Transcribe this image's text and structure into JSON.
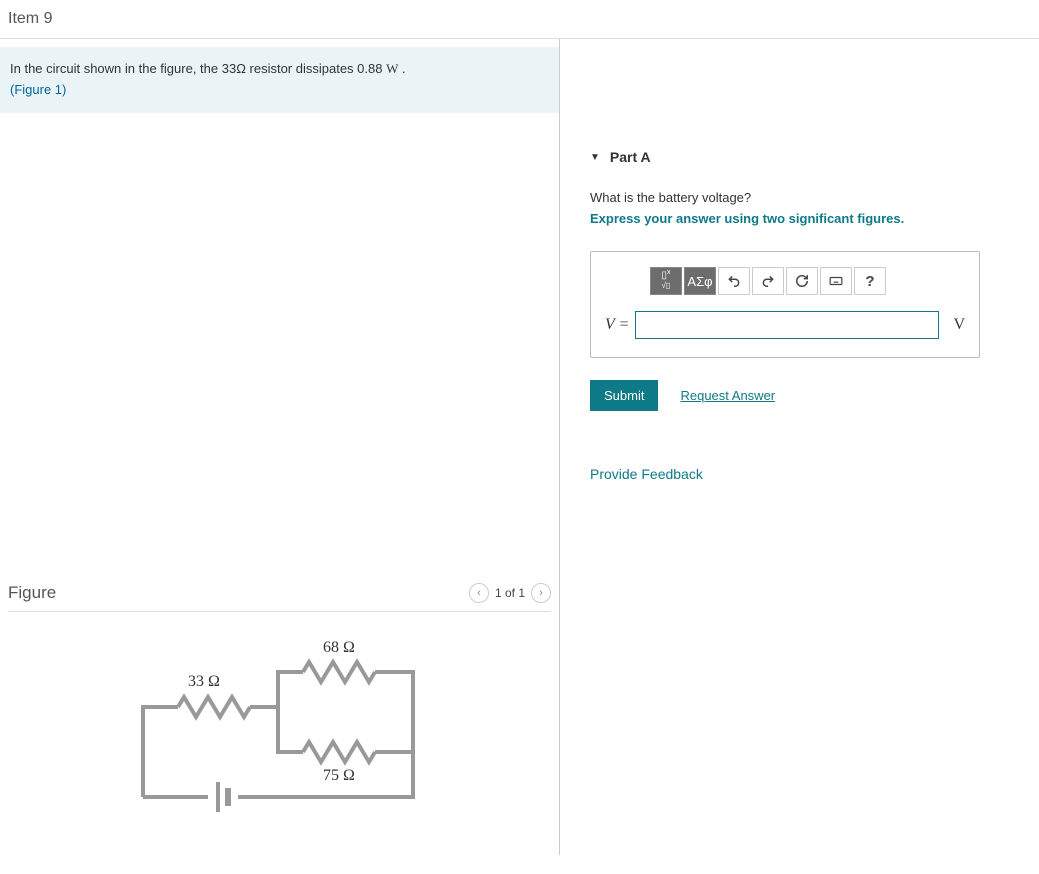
{
  "item_header": "Item 9",
  "problem": {
    "prefix": "In the circuit shown in the figure, the 33",
    "omega1": "Ω",
    "mid": " resistor dissipates 0.88 ",
    "w": "W",
    "suffix": " .",
    "figure_link": "(Figure 1)"
  },
  "figure": {
    "title": "Figure",
    "pager": "1 of 1",
    "r1": "33 Ω",
    "r2": "68 Ω",
    "r3": "75 Ω"
  },
  "partA": {
    "caret": "▼",
    "label": "Part A",
    "question": "What is the battery voltage?",
    "instruction": "Express your answer using two significant figures.",
    "toolbar": {
      "greek": "ΑΣφ",
      "help": "?"
    },
    "var": "V =",
    "unit": "V",
    "submit": "Submit",
    "request": "Request Answer"
  },
  "feedback": "Provide Feedback"
}
